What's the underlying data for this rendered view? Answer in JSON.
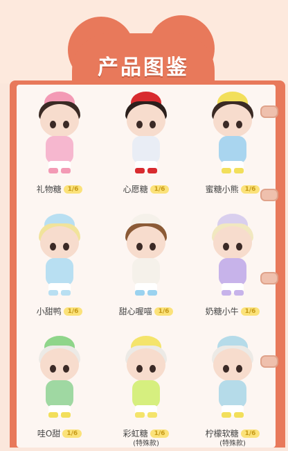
{
  "title": "产品图鉴",
  "items": [
    {
      "name": "礼物糖",
      "badge": "1/6",
      "hair": "#3a2a24",
      "hat": "#f39ab5",
      "body": "#f6b7cf",
      "shoe": "#f39ab5"
    },
    {
      "name": "心愿糖",
      "badge": "1/6",
      "hair": "#2b1f1c",
      "hat": "#d82b2f",
      "body": "#e9edf5",
      "shoe": "#d82b2f"
    },
    {
      "name": "蜜糖小熊",
      "badge": "1/6",
      "hair": "#3a2a24",
      "hat": "#f2df5b",
      "body": "#a9d5ef",
      "shoe": "#f2df5b"
    },
    {
      "name": "小甜鸭",
      "badge": "1/6",
      "hair": "#f1e39b",
      "hat": "#b8dff2",
      "body": "#b8dff2",
      "shoe": "#b8dff2"
    },
    {
      "name": "甜心喔喵",
      "badge": "1/6",
      "hair": "#8b5a36",
      "hat": "#f5f1ea",
      "body": "#f5f1ea",
      "shoe": "#9ad2ef"
    },
    {
      "name": "奶糖小牛",
      "badge": "1/6",
      "hair": "#f1e8c0",
      "hat": "#d9cfee",
      "body": "#c7b3ea",
      "shoe": "#c7b3ea"
    },
    {
      "name": "哇O甜",
      "badge": "1/6",
      "hair": "#eceae6",
      "hat": "#8fd58a",
      "body": "#9fd8a2",
      "shoe": "#f2df5b"
    },
    {
      "name": "彩虹糖",
      "badge": "1/6",
      "sub": "(特殊款)",
      "hair": "#eceae6",
      "hat": "#f4e46b",
      "body": "#d6ef7f",
      "shoe": "#f4e46b"
    },
    {
      "name": "柠檬软糖",
      "badge": "1/6",
      "sub": "(特殊款)",
      "hair": "#eceae6",
      "hat": "#b5dbe9",
      "body": "#b5dbe9",
      "shoe": "#f2df5b"
    }
  ]
}
